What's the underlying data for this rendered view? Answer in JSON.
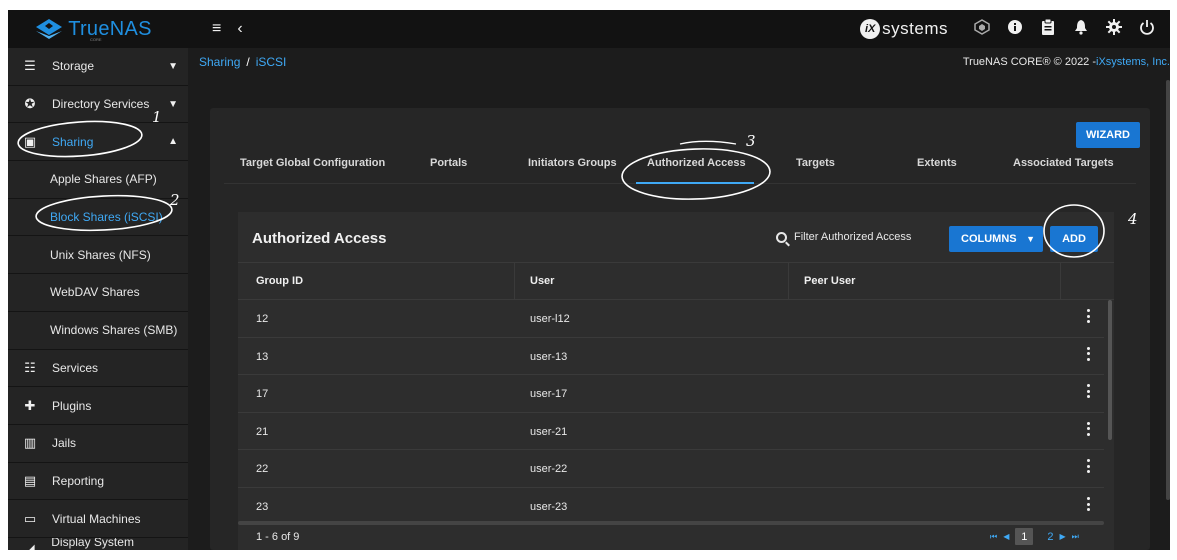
{
  "brand": {
    "name": "TrueNAS",
    "edition": "CORE",
    "color": "#1f8fe0"
  },
  "topbar": {
    "menu_icon": "hamburger-menu-icon",
    "back_icon": "chevron-left-icon",
    "vendor": "systems",
    "icons": [
      "truecommand-icon",
      "info-icon",
      "clipboard-icon",
      "bell-icon",
      "gear-icon",
      "power-icon"
    ]
  },
  "sidebar": {
    "items": [
      {
        "label": "Storage",
        "icon": "storage-icon",
        "caret": "▼"
      },
      {
        "label": "Directory Services",
        "icon": "directory-icon",
        "caret": "▼"
      },
      {
        "label": "Sharing",
        "icon": "sharing-icon",
        "caret": "▲"
      },
      {
        "label": "Apple Shares (AFP)"
      },
      {
        "label": "Block Shares (iSCSI)",
        "active": true
      },
      {
        "label": "Unix Shares (NFS)"
      },
      {
        "label": "WebDAV Shares"
      },
      {
        "label": "Windows Shares (SMB)"
      },
      {
        "label": "Services",
        "icon": "sliders-icon"
      },
      {
        "label": "Plugins",
        "icon": "puzzle-icon"
      },
      {
        "label": "Jails",
        "icon": "jail-icon"
      },
      {
        "label": "Reporting",
        "icon": "chart-icon"
      },
      {
        "label": "Virtual Machines",
        "icon": "laptop-icon"
      },
      {
        "label": "Display System Processes",
        "icon": "terminal-icon"
      }
    ]
  },
  "breadcrumb": {
    "parent": "Sharing",
    "separator": "/",
    "current": "iSCSI"
  },
  "copyright": {
    "text": "TrueNAS CORE® © 2022 - ",
    "link": "iXsystems, Inc."
  },
  "wizard_label": "WIZARD",
  "tabs": [
    "Target Global Configuration",
    "Portals",
    "Initiators Groups",
    "Authorized Access",
    "Targets",
    "Extents",
    "Associated Targets"
  ],
  "active_tab": "Authorized Access",
  "card": {
    "title": "Authorized Access",
    "filter_placeholder": "Filter Authorized Access",
    "columns_label": "COLUMNS",
    "add_label": "ADD"
  },
  "table": {
    "headers": [
      "Group ID",
      "User",
      "Peer User"
    ],
    "rows": [
      {
        "group_id": "12",
        "user": "user-l12",
        "peer_user": ""
      },
      {
        "group_id": "13",
        "user": "user-13",
        "peer_user": ""
      },
      {
        "group_id": "17",
        "user": "user-17",
        "peer_user": ""
      },
      {
        "group_id": "21",
        "user": "user-21",
        "peer_user": ""
      },
      {
        "group_id": "22",
        "user": "user-22",
        "peer_user": ""
      },
      {
        "group_id": "23",
        "user": "user-23",
        "peer_user": ""
      }
    ]
  },
  "pagination": {
    "range": "1 - 6 of 9",
    "pages": [
      "1",
      "2"
    ],
    "current": "1"
  },
  "annotations": [
    "1",
    "2",
    "3",
    "4"
  ],
  "colors": {
    "accent": "#3fa9f5",
    "button": "#1976d2",
    "background": "#1c1c1c",
    "card": "#2d2d2d"
  }
}
